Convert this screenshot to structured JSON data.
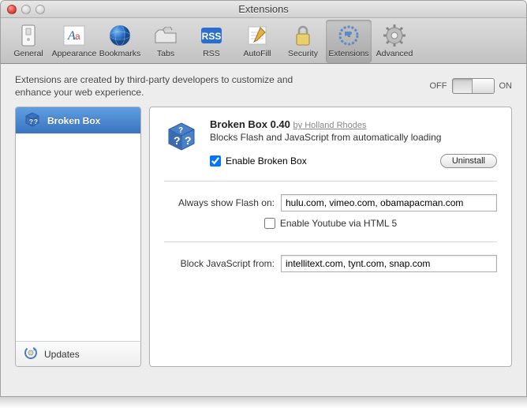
{
  "window_title": "Extensions",
  "toolbar": [
    {
      "id": "general",
      "label": "General"
    },
    {
      "id": "appearance",
      "label": "Appearance"
    },
    {
      "id": "bookmarks",
      "label": "Bookmarks"
    },
    {
      "id": "tabs",
      "label": "Tabs"
    },
    {
      "id": "rss",
      "label": "RSS"
    },
    {
      "id": "autofill",
      "label": "AutoFill"
    },
    {
      "id": "security",
      "label": "Security"
    },
    {
      "id": "extensions",
      "label": "Extensions"
    },
    {
      "id": "advanced",
      "label": "Advanced"
    }
  ],
  "description": "Extensions are created by third-party developers to customize and enhance your web experience.",
  "switch": {
    "off": "OFF",
    "on": "ON",
    "state": "on"
  },
  "sidebar": {
    "items": [
      {
        "label": "Broken Box",
        "selected": true
      }
    ],
    "footer_label": "Updates"
  },
  "extension": {
    "name": "Broken Box",
    "version": "0.40",
    "author_prefix": "by",
    "author": "Holland Rhodes",
    "description": "Blocks Flash and JavaScript from automatically loading",
    "enable_label": "Enable Broken Box",
    "enable_checked": true,
    "uninstall_label": "Uninstall",
    "flash_label": "Always show Flash on:",
    "flash_value": "hulu.com, vimeo.com, obamapacman.com",
    "youtube_label": "Enable Youtube via HTML 5",
    "youtube_checked": false,
    "js_label": "Block JavaScript from:",
    "js_value": "intellitext.com, tynt.com, snap.com"
  }
}
